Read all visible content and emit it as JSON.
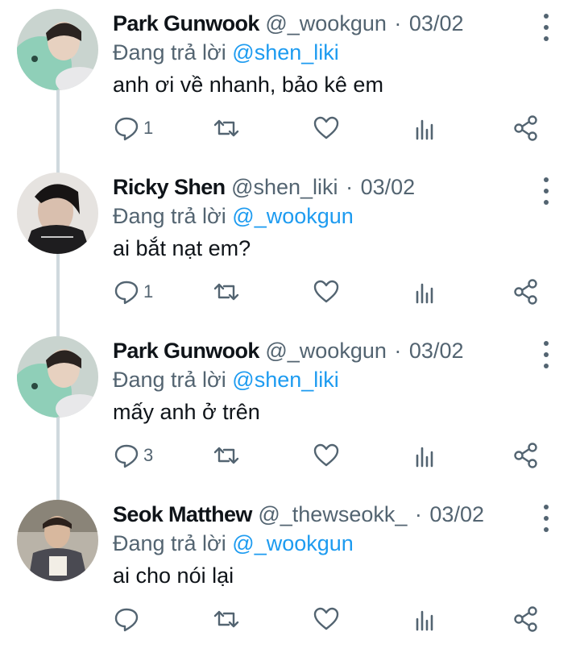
{
  "replying_label": "Đang trả lời",
  "tweets": [
    {
      "name": "Park Gunwook",
      "handle": "@_wookgun",
      "date": "03/02",
      "reply_to": "@shen_liki",
      "text": "anh ơi về nhanh, bảo kê em",
      "reply_count": "1"
    },
    {
      "name": "Ricky Shen",
      "handle": "@shen_liki",
      "date": "03/02",
      "reply_to": "@_wookgun",
      "text": "ai bắt nạt em?",
      "reply_count": "1"
    },
    {
      "name": "Park Gunwook",
      "handle": "@_wookgun",
      "date": "03/02",
      "reply_to": "@shen_liki",
      "text": "mấy anh ở trên",
      "reply_count": "3"
    },
    {
      "name": "Seok Matthew",
      "handle": "@_thewseokk_",
      "date": "03/02",
      "reply_to": "@_wookgun",
      "text": "ai cho nói lại",
      "reply_count": ""
    }
  ],
  "separator": "·",
  "icons": {
    "reply": "comment-icon",
    "retweet": "retweet-icon",
    "like": "heart-icon",
    "views": "bar-chart-icon",
    "share": "share-icon",
    "more": "more-vertical-icon"
  },
  "colors": {
    "text": "#0f1419",
    "secondary": "#536471",
    "accent": "#1d9bf0",
    "thread_line": "#cfd9de"
  }
}
